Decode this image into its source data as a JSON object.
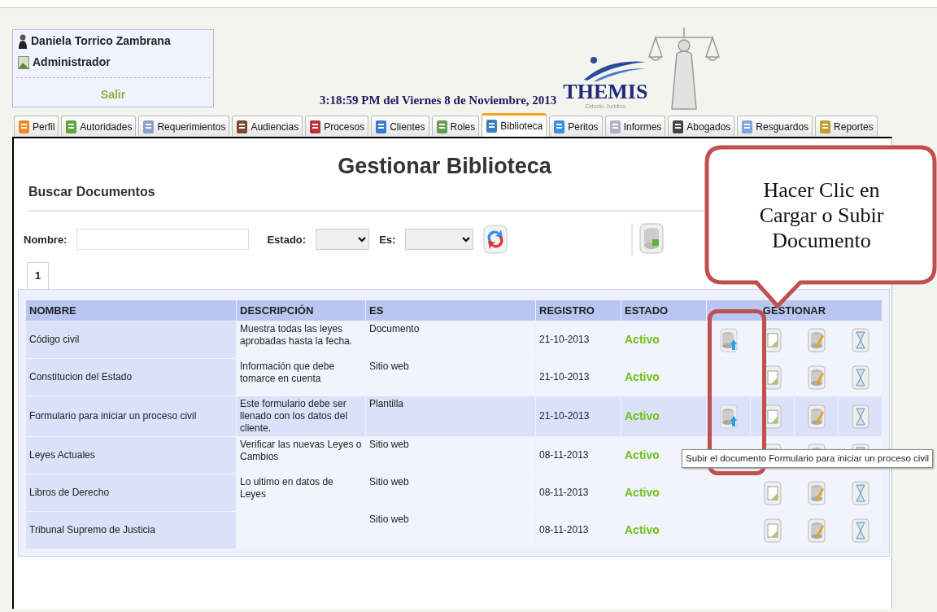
{
  "user": {
    "name": "Daniela Torrico Zambrana",
    "role": "Administrador",
    "logout": "Salir"
  },
  "datetime": "3:18:59 PM del Viernes 8 de Noviembre, 2013",
  "logo": {
    "name": "THEMIS",
    "tagline": "Estudio Juridico"
  },
  "tabs": [
    {
      "label": "Perfil",
      "selected": false
    },
    {
      "label": "Autoridades",
      "selected": false
    },
    {
      "label": "Requerimientos",
      "selected": false
    },
    {
      "label": "Audiencias",
      "selected": false
    },
    {
      "label": "Procesos",
      "selected": false
    },
    {
      "label": "Clientes",
      "selected": false
    },
    {
      "label": "Roles",
      "selected": false
    },
    {
      "label": "Biblioteca",
      "selected": true
    },
    {
      "label": "Peritos",
      "selected": false
    },
    {
      "label": "Informes",
      "selected": false
    },
    {
      "label": "Abogados",
      "selected": false
    },
    {
      "label": "Resguardos",
      "selected": false
    },
    {
      "label": "Reportes",
      "selected": false
    }
  ],
  "page_title": "Gestionar Biblioteca",
  "section_title": "Buscar Documentos",
  "filters": {
    "name_label": "Nombre:",
    "estado_label": "Estado:",
    "es_label": "Es:"
  },
  "pager": [
    {
      "label": "1",
      "selected": true
    }
  ],
  "table": {
    "columns": [
      "NOMBRE",
      "DESCRIPCIÓN",
      "ES",
      "REGISTRO",
      "ESTADO",
      "GESTIONAR"
    ],
    "rows": [
      {
        "name": "Código civil",
        "description": "Muestra todas las leyes aprobadas hasta la fecha.",
        "type": "Documento",
        "date": "21-10-2013",
        "status": "Activo",
        "can_upload": true,
        "highlighted": false
      },
      {
        "name": "Constitucion del Estado",
        "description": "Información que debe tomarce en cuenta",
        "type": "Sitio web",
        "date": "21-10-2013",
        "status": "Activo",
        "can_upload": false,
        "highlighted": false
      },
      {
        "name": "Formulario para iniciar un proceso civil",
        "description": "Este formulario debe ser llenado con los datos del cliente.",
        "type": "Plantilla",
        "date": "21-10-2013",
        "status": "Activo",
        "can_upload": true,
        "highlighted": true
      },
      {
        "name": "Leyes Actuales",
        "description": "Verificar las nuevas Leyes o Cambios",
        "type": "Sitio web",
        "date": "08-11-2013",
        "status": "Activo",
        "can_upload": false,
        "highlighted": false
      },
      {
        "name": "Libros de Derecho",
        "description": "Lo ultimo en datos de Leyes",
        "type": "Sitio web",
        "date": "08-11-2013",
        "status": "Activo",
        "can_upload": false,
        "highlighted": false
      },
      {
        "name": "Tribunal Supremo de Justicia",
        "description": "",
        "type": "Sitio web",
        "date": "08-11-2013",
        "status": "Activo",
        "can_upload": false,
        "highlighted": false
      }
    ]
  },
  "tooltip": "Subir el documento Formulario para iniciar un proceso civil",
  "callout": "Hacer Clic en Cargar o Subir Documento"
}
